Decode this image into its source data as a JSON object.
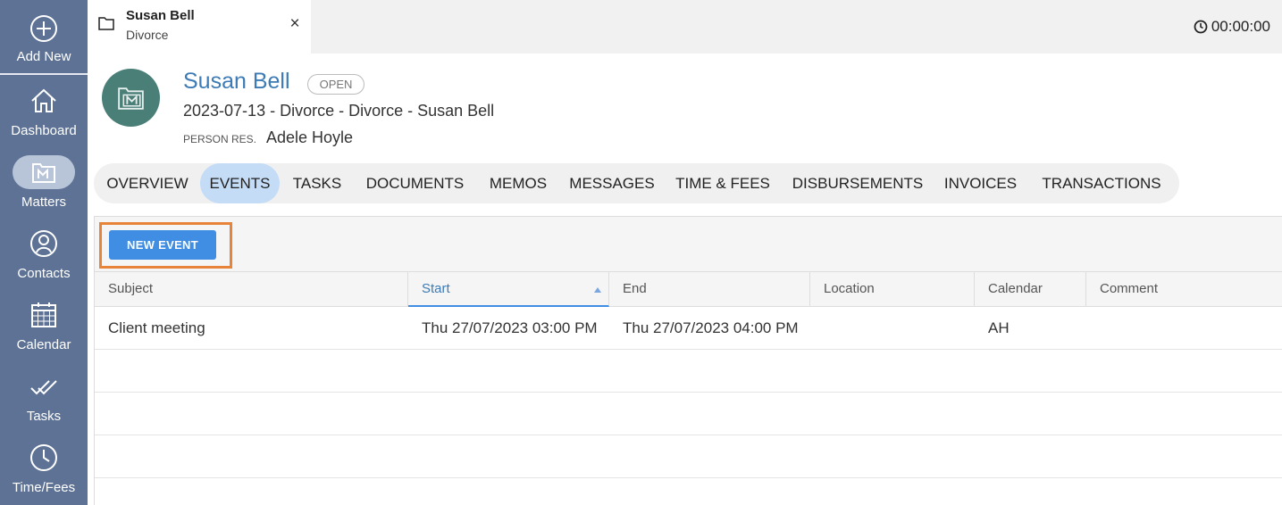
{
  "sidebar": {
    "items": [
      {
        "label": "Add New",
        "icon": "plus-circle-icon"
      },
      {
        "label": "Dashboard",
        "icon": "home-icon"
      },
      {
        "label": "Matters",
        "icon": "folder-m-icon"
      },
      {
        "label": "Contacts",
        "icon": "user-circle-icon"
      },
      {
        "label": "Calendar",
        "icon": "calendar-icon"
      },
      {
        "label": "Tasks",
        "icon": "double-check-icon"
      },
      {
        "label": "Time/Fees",
        "icon": "clock-icon"
      }
    ],
    "active": "Matters"
  },
  "topbar": {
    "tab": {
      "title": "Susan Bell",
      "subtitle": "Divorce",
      "close": "×"
    },
    "timer": "00:00:00"
  },
  "matter": {
    "name": "Susan Bell",
    "status": "OPEN",
    "description": "2023-07-13 - Divorce - Divorce - Susan Bell",
    "responsible_label": "PERSON RES.",
    "responsible_value": "Adele Hoyle"
  },
  "tabs": [
    "OVERVIEW",
    "EVENTS",
    "TASKS",
    "DOCUMENTS",
    "MEMOS",
    "MESSAGES",
    "TIME & FEES",
    "DISBURSEMENTS",
    "INVOICES",
    "TRANSACTIONS"
  ],
  "active_tab": "EVENTS",
  "toolbar": {
    "new_event_label": "NEW EVENT"
  },
  "table": {
    "columns": [
      "Subject",
      "Start",
      "End",
      "Location",
      "Calendar",
      "Comment"
    ],
    "sorted_column": "Start",
    "rows": [
      {
        "subject": "Client meeting",
        "start": "Thu 27/07/2023 03:00 PM",
        "end": "Thu 27/07/2023 04:00 PM",
        "location": "",
        "calendar": "AH",
        "comment": ""
      }
    ]
  },
  "colors": {
    "sidebar": "#5d7294",
    "accent": "#3f8ee3",
    "title": "#3c7bb5",
    "avatar": "#4a7f78",
    "highlight": "#e8843a",
    "active_tab": "#c4dcf6"
  }
}
